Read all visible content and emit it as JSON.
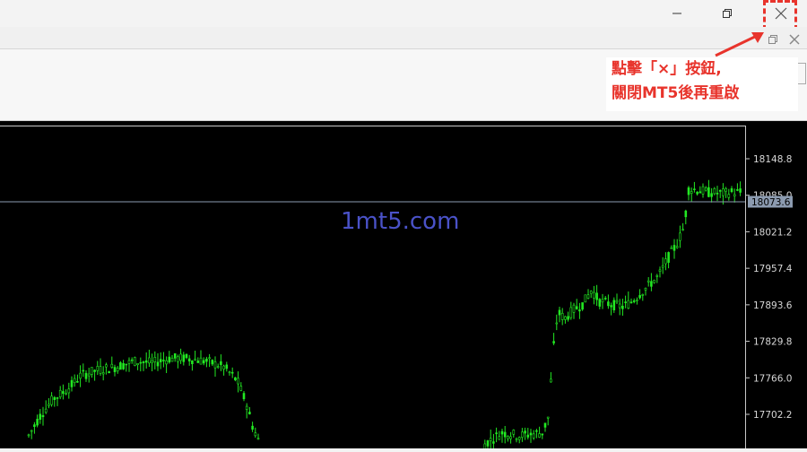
{
  "window": {
    "minimize_icon": "minimize-icon",
    "restore_icon": "restore-icon",
    "close_icon": "close-icon"
  },
  "annotation": {
    "line1": "點擊「×」按鈕,",
    "line2": "關閉MT5後再重啟",
    "color": "#e8342c"
  },
  "watermark": "1mt5.com",
  "chart_data": {
    "type": "candlestick",
    "ylim": [
      17660,
      18190
    ],
    "y_ticks": [
      "18148.8",
      "18085.0",
      "18021.2",
      "17957.4",
      "17893.6",
      "17829.8",
      "17766.0",
      "17702.2"
    ],
    "current_price": "18073.6",
    "candle_color": "#22e822",
    "closes": [
      17665,
      17690,
      17720,
      17735,
      17740,
      17728,
      17745,
      17760,
      17758,
      17770,
      17775,
      17780,
      17778,
      17790,
      17795,
      17788,
      17800,
      17805,
      17798,
      17810,
      17808,
      17815,
      17812,
      17818,
      17816,
      17812,
      17808,
      17805,
      17810,
      17806,
      17800,
      17795,
      17790,
      17760,
      17730,
      17690,
      17660,
      17660,
      17660,
      17660,
      17660,
      17662,
      17665,
      17668,
      17670,
      17672,
      17675,
      17680,
      17686,
      17690,
      17692,
      17690,
      17688,
      17694,
      17700,
      17705,
      17708,
      17712,
      17716,
      17720,
      17726,
      17731,
      17737,
      17741,
      17746,
      17750,
      17755,
      17760,
      17762,
      17765,
      17760,
      17755,
      17750,
      17745,
      17740,
      17735,
      17730,
      17735,
      17740,
      17745,
      17748,
      17750,
      17752,
      17748,
      17744,
      17740,
      17736,
      17732,
      17728,
      17724,
      17720,
      17718,
      17716,
      17712,
      17710,
      17706,
      17702,
      17700,
      17700,
      17702,
      17704,
      17706,
      17710,
      17712,
      17714,
      17716,
      17718,
      17720,
      17722,
      17724,
      17726,
      17728,
      17730,
      17732,
      17734,
      17736,
      17738,
      17740,
      17742,
      17744,
      17746,
      17748,
      17750,
      17752,
      17754,
      17756,
      17758,
      17760,
      17762,
      17764,
      17766,
      17660,
      17662,
      17664,
      17666,
      17668,
      17670,
      17672,
      17674,
      17676,
      17678,
      17680,
      17682,
      17684,
      17686,
      17688,
      17690,
      17692,
      17694,
      17696,
      17698,
      17700,
      17702,
      17704,
      17706,
      17708,
      17710,
      17712,
      17714,
      17716,
      17718,
      17720,
      17722,
      17724,
      17726,
      17728,
      17730,
      17732,
      17734,
      17736,
      17738,
      17740,
      17742,
      17744,
      17746,
      17748,
      17750,
      17752,
      17754,
      17756,
      17758,
      17760,
      17762,
      17764,
      17766,
      17768,
      17770,
      17772,
      17774,
      17776,
      17778,
      17780,
      17782,
      17784,
      17786,
      17788,
      17790,
      17792,
      17794,
      17796,
      17798,
      17800,
      17802,
      17804,
      17806,
      17808,
      17810,
      17812,
      17814,
      17816,
      17818,
      17820,
      17822,
      17824,
      17826,
      17828,
      17830,
      17832,
      17834,
      17836,
      17838,
      17840,
      17842,
      17844,
      17846,
      17848,
      17850,
      17852,
      17854,
      17856,
      17858,
      17860,
      17862,
      17864,
      17866,
      17868,
      17870,
      17872,
      17874,
      17876,
      17878,
      17880,
      17882,
      17884,
      17886,
      17888,
      17890,
      17892,
      17894,
      17896,
      17898,
      17900,
      17902,
      17904,
      17906,
      17908,
      17910,
      17912,
      17914,
      17916,
      17918,
      17920,
      17922,
      17924,
      17926,
      17928,
      17930,
      17932,
      17934,
      17936,
      17938,
      17940,
      17942,
      17944,
      17946,
      17948,
      17950,
      17952,
      17954,
      17956,
      17958,
      17960,
      17962,
      17964,
      17966,
      17968,
      17970,
      17972,
      17974,
      17976,
      17978,
      17980,
      17982,
      17984,
      17986,
      17988,
      17990,
      17992,
      17994,
      17996,
      17998,
      18000,
      18002,
      18004,
      18006,
      18008,
      18010,
      18012,
      18014,
      18016,
      18018,
      18020,
      18022,
      18024,
      18026,
      18028,
      18030,
      18032,
      18034,
      18036,
      18038,
      18040,
      18042,
      18044,
      18046,
      18048,
      18050,
      18052,
      18054,
      18056,
      18058,
      18060,
      18062,
      18064,
      18066,
      18068,
      18070,
      18072,
      18074,
      18076,
      18078,
      18080,
      18082,
      18084,
      18086,
      18088,
      18090,
      18092,
      18094,
      18096,
      18098,
      18100,
      18102,
      18104,
      18106,
      18108,
      18110,
      18112,
      18114,
      18116,
      18118,
      18120,
      18122,
      18124,
      18126,
      18128,
      18130,
      18132,
      18134,
      18136,
      18138,
      18140,
      18142,
      18144,
      18146,
      18148,
      18150,
      18152,
      18154,
      18156,
      18158,
      18160,
      18162,
      18164,
      18166,
      18168,
      18170,
      18172,
      18174,
      18176,
      18178,
      18180,
      18182,
      18184,
      18186,
      18188,
      18190,
      18190,
      18188,
      18186,
      18184,
      18182,
      18180,
      18178,
      18176,
      18174,
      18172,
      18170,
      18168,
      18166,
      18164,
      18162,
      18160,
      18158,
      18156,
      18154,
      18152,
      18150,
      18148,
      18146,
      18144,
      18142,
      18140,
      18138,
      18136,
      18134,
      18132,
      18130,
      18128,
      18126,
      18124,
      18122,
      18120,
      18118,
      18116,
      18114,
      18112,
      18110,
      18108,
      18106,
      18104,
      18102,
      18100,
      18098,
      18096,
      18094,
      18092,
      18090,
      18088,
      18086,
      18084,
      18082,
      18080,
      18078,
      18076,
      18074
    ]
  }
}
